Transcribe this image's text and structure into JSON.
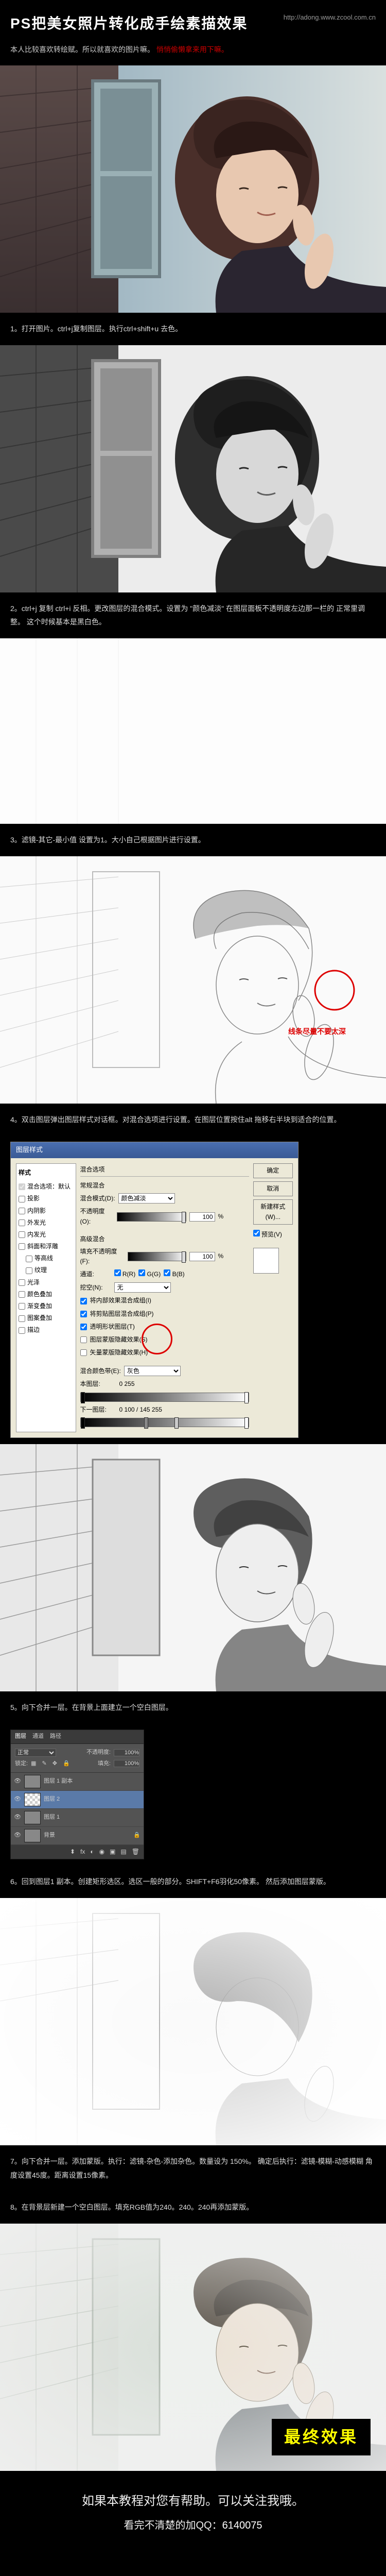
{
  "header": {
    "title": "PS把美女照片转化成手绘素描效果",
    "url": "http://adong.www.zcool.com.cn"
  },
  "intro": {
    "text": "本人比较喜欢转绘赋。所以就喜欢的图片嘛。",
    "red": "悄悄偷懒拿来用下嘛。"
  },
  "steps": {
    "s1": "1。打开图片。ctrl+j复制图层。执行ctrl+shift+u 去色。",
    "s2": "2。ctrl+j 复制 ctrl+i 反相。更改图层的混合模式。设置为 \"颜色减淡\" 在图层面板不透明度左边那一栏的 正常里调整。 这个时候基本是黑白色。",
    "s3": "3。滤镜-其它-最小值 设置为1。大小自己根据图片进行设置。",
    "s3_annot": "线条尽量不要太深",
    "s4": "4。双击图层弹出图层样式对话框。对混合选项进行设置。在图层位置按住alt 拖移右半块到适合的位置。",
    "s5": "5。向下合并一层。在背景上面建立一个空白图层。",
    "s6": "6。回到图层1 副本。创建矩形选区。选区一般的部分。SHIFT+F6羽化50像素。 然后添加图层蒙版。",
    "s7": "7。向下合并一层。添加蒙版。执行：滤镜-杂色-添加杂色。数量设为 150%。 确定后执行：滤镜-模糊-动感模糊 角度设置45度。距离设置15像素。",
    "s8": "8。在背景层新建一个空白图层。填充RGB值为240。240。240再添加蒙版。"
  },
  "dialog": {
    "title": "图层样式",
    "left_header": "样式",
    "left_items": [
      "混合选项：默认",
      "投影",
      "内阴影",
      "外发光",
      "内发光",
      "斜面和浮雕",
      "等高线",
      "纹理",
      "光泽",
      "颜色叠加",
      "渐变叠加",
      "图案叠加",
      "描边"
    ],
    "mid": {
      "sec1_title": "混合选项",
      "sec1_sub": "常规混合",
      "blend_mode_label": "混合模式(D):",
      "blend_mode_value": "颜色减淡",
      "opacity_label": "不透明度(O):",
      "opacity_value": "100",
      "pct": "%",
      "sec2_sub": "高级混合",
      "fill_label": "填充不透明度(F):",
      "fill_value": "100",
      "channels_label": "通道:",
      "ch_r": "R(R)",
      "ch_g": "G(G)",
      "ch_b": "B(B)",
      "knockout_label": "挖空(N):",
      "knockout_value": "无",
      "adv1": "将内部效果混合成组(I)",
      "adv2": "将剪贴图层混合成组(P)",
      "adv3": "透明形状图层(T)",
      "adv4": "图层蒙版隐藏效果(S)",
      "adv5": "矢量蒙版隐藏效果(H)",
      "sec3_sub": "混合颜色带(E):",
      "sec3_val": "灰色",
      "this_layer": "本图层:",
      "this_vals": "0       255",
      "under_layer": "下一图层:",
      "under_vals": "0   100 / 145   255"
    },
    "btns": [
      "确定",
      "取消",
      "新建样式(W)...",
      "预览(V)"
    ]
  },
  "layers": {
    "tabs": [
      "图层",
      "通道",
      "路径"
    ],
    "mode_label": "正常",
    "opacity_label": "不透明度:",
    "opacity_value": "100%",
    "lock_label": "锁定:",
    "fill_label": "填充:",
    "fill_value": "100%",
    "rows": [
      {
        "name": "图层 1 副本",
        "thumb": "img"
      },
      {
        "name": "图层 2",
        "thumb": "checker"
      },
      {
        "name": "图层 1",
        "thumb": "img"
      },
      {
        "name": "背景",
        "thumb": "img",
        "locked": true
      }
    ]
  },
  "final_label": "最终效果",
  "footer": {
    "line1": "如果本教程对您有帮助。可以关注我哦。",
    "line2_a": "看完不清楚的加QQ：",
    "line2_b": "6140075"
  }
}
